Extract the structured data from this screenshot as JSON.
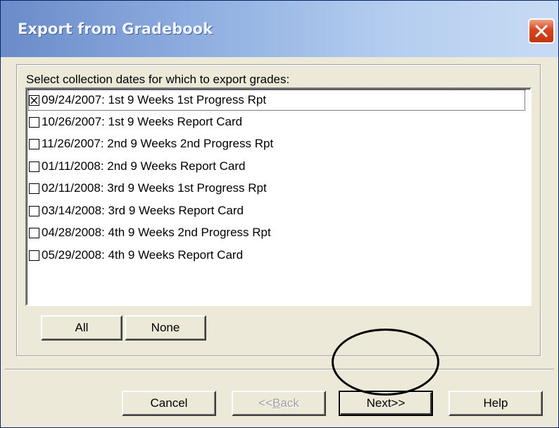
{
  "window": {
    "title": "Export from Gradebook",
    "close_icon": "close-icon",
    "colors": {
      "title_bar": "#8eaee0",
      "close_button": "#d5441e",
      "dialog_face": "#ece9d8"
    }
  },
  "collection": {
    "label": "Select collection dates for which to export grades:",
    "items": [
      {
        "label": "09/24/2007: 1st 9 Weeks 1st Progress Rpt",
        "checked": true
      },
      {
        "label": "10/26/2007: 1st 9 Weeks Report Card",
        "checked": false
      },
      {
        "label": "11/26/2007: 2nd 9 Weeks 2nd Progress Rpt",
        "checked": false
      },
      {
        "label": "01/11/2008: 2nd 9 Weeks Report Card",
        "checked": false
      },
      {
        "label": "02/11/2008: 3rd 9 Weeks 1st Progress Rpt",
        "checked": false
      },
      {
        "label": "03/14/2008: 3rd 9 Weeks Report Card",
        "checked": false
      },
      {
        "label": "04/28/2008: 4th 9 Weeks 2nd Progress Rpt",
        "checked": false
      },
      {
        "label": "05/29/2008: 4th 9 Weeks Report Card",
        "checked": false
      }
    ],
    "all_label": "All",
    "none_label": "None"
  },
  "buttons": {
    "cancel": "Cancel",
    "back_prefix": "<<",
    "back_key": "B",
    "back_rest": "ack",
    "next": "Next>>",
    "help": "Help"
  }
}
